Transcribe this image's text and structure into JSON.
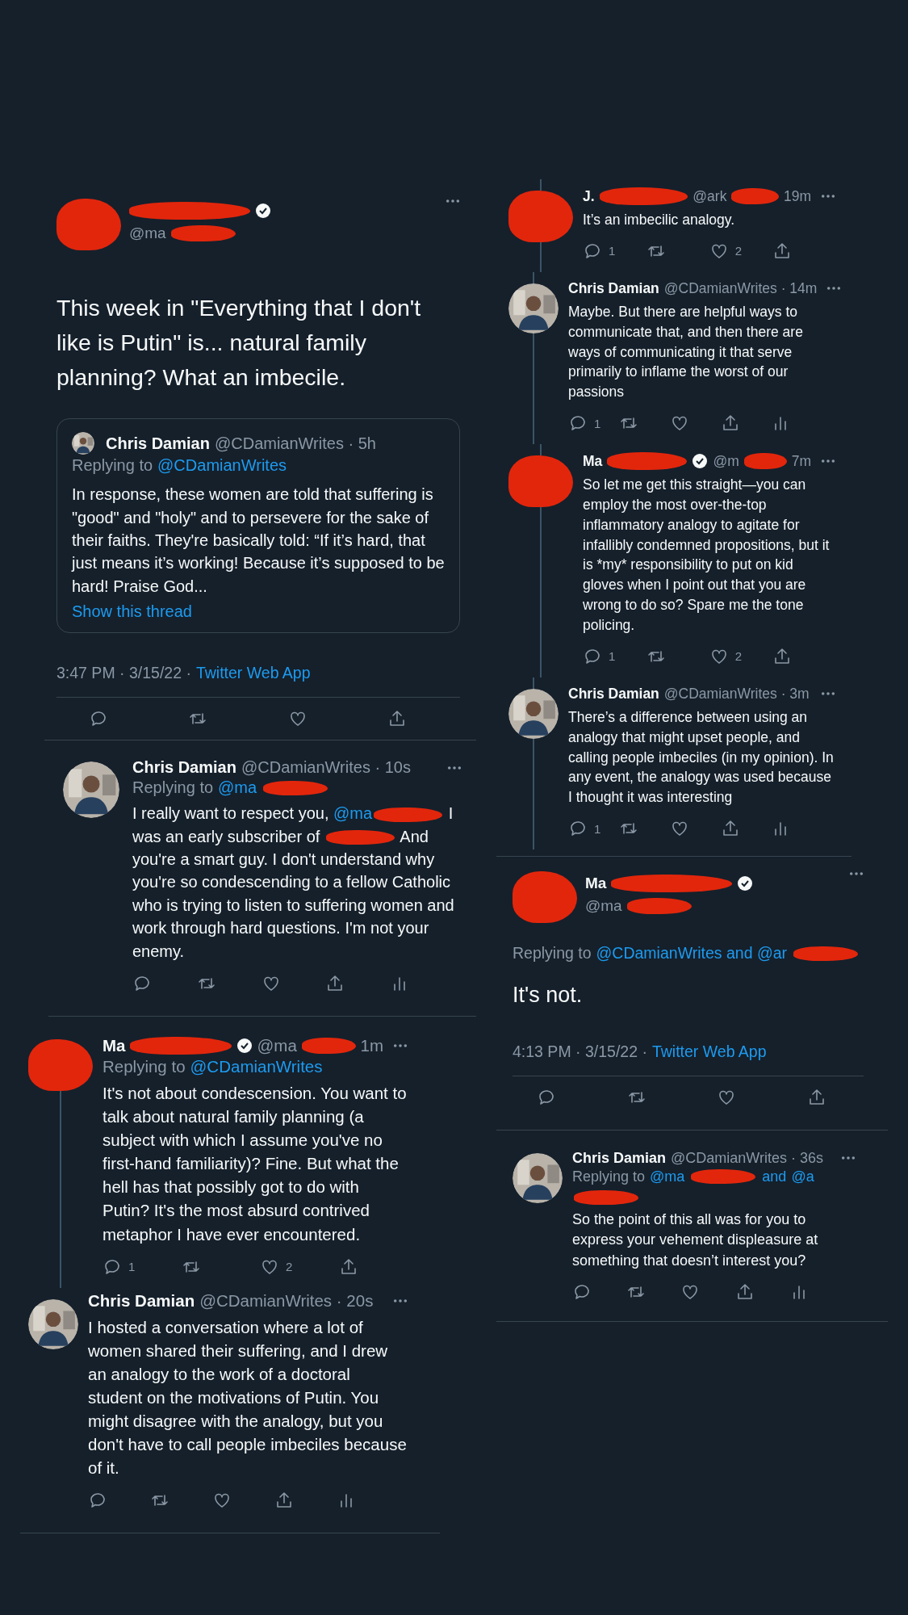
{
  "columns": [
    {
      "panels": [
        {
          "kind": "focal",
          "tweet": {
            "avatar": {
              "kind": "redacted"
            },
            "name_redacted": true,
            "verified": true,
            "handle": "@ma",
            "handle_redacted": true,
            "text": "This week in \"Everything that I don't like is Putin\" is... natural family planning? What an imbecile.",
            "quote": {
              "avatar": {
                "kind": "photo"
              },
              "name": "Chris Damian",
              "handle": "@CDamianWrites · 5h",
              "replying": {
                "label": "Replying to",
                "targets": [
                  {
                    "text": "@CDamianWrites",
                    "redacted": false
                  }
                ]
              },
              "text": "In response, these women are told that suffering is \"good\" and \"holy\" and to persevere for the sake of their faiths. They're basically told: “If it’s hard, that just means it’s working! Because it’s supposed to be hard! Praise God...",
              "link": "Show this thread"
            },
            "timestamp": "3:47 PM · 3/15/22 ·",
            "source": "Twitter Web App",
            "actions": [
              {
                "kind": "reply"
              },
              {
                "kind": "retweet"
              },
              {
                "kind": "like"
              },
              {
                "kind": "share"
              }
            ]
          }
        },
        {
          "kind": "thread",
          "tweets": [
            {
              "avatar": {
                "kind": "photo"
              },
              "name": "Chris Damian",
              "verified": false,
              "handle": "@CDamianWrites · 10s",
              "replying": {
                "label": "Replying to",
                "targets": [
                  {
                    "text": "@ma",
                    "redacted": true
                  }
                ]
              },
              "segments": [
                {
                  "kind": "plain",
                  "text": "I really want to respect you, "
                },
                {
                  "kind": "mention",
                  "text": "@ma"
                },
                {
                  "kind": "redaction"
                },
                {
                  "kind": "plain",
                  "text": " I was an early subscriber of "
                },
                {
                  "kind": "redaction"
                },
                {
                  "kind": "plain",
                  "text": " And you're a smart guy. I don't understand why you're so condescending to a fellow Catholic who is trying to listen to suffering women and work through hard questions. I'm not your enemy."
                }
              ],
              "actions": [
                {
                  "kind": "reply"
                },
                {
                  "kind": "retweet"
                },
                {
                  "kind": "like"
                },
                {
                  "kind": "share"
                },
                {
                  "kind": "analytics"
                }
              ],
              "line_above": false,
              "line_below": false
            }
          ]
        },
        {
          "kind": "thread",
          "tweets": [
            {
              "avatar": {
                "kind": "redacted"
              },
              "name": "Ma",
              "name_redacted": true,
              "verified": true,
              "handle": "@ma",
              "handle_redacted": true,
              "time": "1m",
              "replying": {
                "label": "Replying to",
                "targets": [
                  {
                    "text": "@CDamianWrites",
                    "redacted": false
                  }
                ]
              },
              "text": "It's not about condescension. You want to talk about natural family planning (a subject with which I assume you've no first-hand familiarity)? Fine. But what the hell has that possibly got to do with Putin? It's the most absurd contrived metaphor I have ever encountered.",
              "actions": [
                {
                  "kind": "reply",
                  "count": "1"
                },
                {
                  "kind": "retweet"
                },
                {
                  "kind": "like",
                  "count": "2"
                },
                {
                  "kind": "share"
                }
              ],
              "line_above": false,
              "line_below": true
            },
            {
              "avatar": {
                "kind": "photo"
              },
              "name": "Chris Damian",
              "verified": false,
              "handle": "@CDamianWrites · 20s",
              "text": "I hosted a conversation where a lot of women shared their suffering, and I drew an analogy to the work of a doctoral student on the motivations of Putin. You might disagree with the analogy, but you don't have to call people imbeciles because of it.",
              "actions": [
                {
                  "kind": "reply"
                },
                {
                  "kind": "retweet"
                },
                {
                  "kind": "like"
                },
                {
                  "kind": "share"
                },
                {
                  "kind": "analytics"
                }
              ],
              "line_above": false,
              "line_below": false
            }
          ]
        }
      ]
    },
    {
      "panels": [
        {
          "kind": "thread",
          "tweets": [
            {
              "avatar": {
                "kind": "redacted"
              },
              "name": "J.",
              "name_redacted": true,
              "verified": false,
              "handle": "@ark",
              "handle_redacted": true,
              "time": "19m",
              "text": "It’s an imbecilic analogy.",
              "actions": [
                {
                  "kind": "reply",
                  "count": "1"
                },
                {
                  "kind": "retweet"
                },
                {
                  "kind": "like",
                  "count": "2"
                },
                {
                  "kind": "share"
                }
              ],
              "line_above": true,
              "line_below": true
            },
            {
              "avatar": {
                "kind": "photo"
              },
              "name": "Chris Damian",
              "verified": false,
              "handle": "@CDamianWrites · 14m",
              "text": "Maybe. But there are helpful ways to communicate that, and then there are ways of communicating it that serve primarily to inflame the worst of our passions",
              "actions": [
                {
                  "kind": "reply",
                  "count": "1"
                },
                {
                  "kind": "retweet"
                },
                {
                  "kind": "like"
                },
                {
                  "kind": "share"
                },
                {
                  "kind": "analytics"
                }
              ],
              "line_above": true,
              "line_below": true
            },
            {
              "avatar": {
                "kind": "redacted"
              },
              "name": "Ma",
              "name_redacted": true,
              "verified": true,
              "handle": "@m",
              "handle_redacted": true,
              "time": "7m",
              "text": "So let me get this straight—you can employ the most over-the-top inflammatory analogy to agitate for infallibly condemned propositions, but it is *my* responsibility to put on kid gloves when I point out that you are wrong to do so? Spare me the tone policing.",
              "actions": [
                {
                  "kind": "reply",
                  "count": "1"
                },
                {
                  "kind": "retweet"
                },
                {
                  "kind": "like",
                  "count": "2"
                },
                {
                  "kind": "share"
                }
              ],
              "line_above": true,
              "line_below": true
            },
            {
              "avatar": {
                "kind": "photo"
              },
              "name": "Chris Damian",
              "verified": false,
              "handle": "@CDamianWrites · 3m",
              "text": "There’s a difference between using an analogy that might upset people, and calling people imbeciles (in my opinion). In any event, the analogy was used because I thought it was interesting",
              "actions": [
                {
                  "kind": "reply",
                  "count": "1"
                },
                {
                  "kind": "retweet"
                },
                {
                  "kind": "like"
                },
                {
                  "kind": "share"
                },
                {
                  "kind": "analytics"
                }
              ],
              "line_above": true,
              "line_below": true
            }
          ]
        },
        {
          "kind": "focal",
          "tweet": {
            "avatar": {
              "kind": "redacted"
            },
            "name": "Ma",
            "name_redacted": true,
            "verified": true,
            "handle": "@ma",
            "handle_redacted": true,
            "replying": {
              "label": "Replying to",
              "targets": [
                {
                  "text": "@CDamianWrites and @ar",
                  "redacted": true
                }
              ]
            },
            "text": "It's not.",
            "timestamp": "4:13 PM · 3/15/22 ·",
            "source": "Twitter Web App",
            "actions": [
              {
                "kind": "reply"
              },
              {
                "kind": "retweet"
              },
              {
                "kind": "like"
              },
              {
                "kind": "share"
              }
            ]
          }
        },
        {
          "kind": "thread",
          "tweets": [
            {
              "avatar": {
                "kind": "photo"
              },
              "name": "Chris Damian",
              "verified": false,
              "handle": "@CDamianWrites · 36s",
              "replying": {
                "label": "Replying to",
                "targets": [
                  {
                    "text": "@ma",
                    "redacted": true
                  },
                  {
                    "text": "and",
                    "redacted": false
                  },
                  {
                    "text": "@a",
                    "redacted": true
                  }
                ]
              },
              "text": "So the point of this all was for you to express your vehement displeasure at something that doesn’t interest you?",
              "actions": [
                {
                  "kind": "reply"
                },
                {
                  "kind": "retweet"
                },
                {
                  "kind": "like"
                },
                {
                  "kind": "share"
                },
                {
                  "kind": "analytics"
                }
              ],
              "line_above": false,
              "line_below": false
            }
          ]
        }
      ]
    }
  ]
}
